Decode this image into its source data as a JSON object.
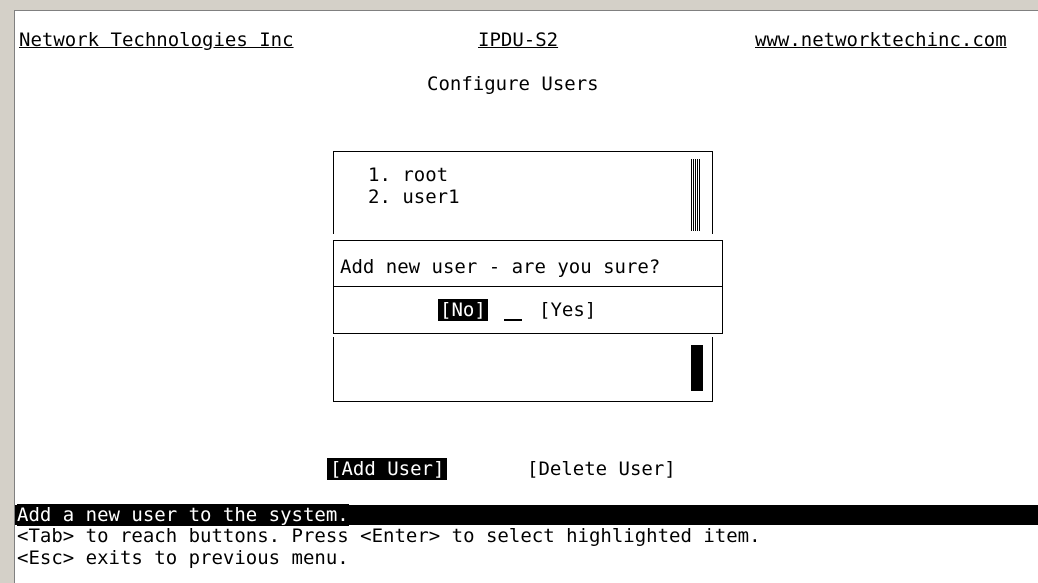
{
  "header": {
    "company": "Network Technologies Inc",
    "product": "IPDU-S2",
    "website": "www.networktechinc.com"
  },
  "page_title": "Configure Users",
  "users": [
    {
      "label": "1. root"
    },
    {
      "label": "2. user1"
    }
  ],
  "dialog": {
    "message": "Add new user - are you sure?",
    "no_button": "[No]",
    "yes_button": "[Yes]"
  },
  "buttons": {
    "add_user": "[Add User]",
    "delete_user": "[Delete User]"
  },
  "status": {
    "description": "Add a new user to the system.",
    "hint_tab": "<Tab> to reach buttons. Press <Enter> to select highlighted item.",
    "hint_esc": "<Esc> exits to previous menu."
  }
}
